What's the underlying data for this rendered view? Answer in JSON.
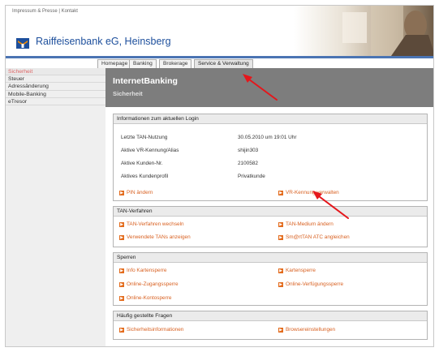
{
  "header": {
    "toplinks": [
      "Impressum & Presse",
      "Kontakt"
    ],
    "bank_name": "Raiffeisenbank eG, Heinsberg"
  },
  "tabs": [
    {
      "label": "Homepage"
    },
    {
      "label": "Banking"
    },
    {
      "label": "Brokerage"
    },
    {
      "label": "Service & Verwaltung"
    }
  ],
  "sidebar": {
    "items": [
      {
        "label": "Sicherheit"
      },
      {
        "label": "Steuer"
      },
      {
        "label": "Adressänderung"
      },
      {
        "label": "Mobile-Banking"
      },
      {
        "label": "eTresor"
      }
    ]
  },
  "hero": {
    "title": "InternetBanking",
    "subtitle": "Sicherheit"
  },
  "login_panel": {
    "title": "Informationen zum aktuellen Login",
    "rows": [
      {
        "label": "Letzte TAN-Nutzung",
        "value": "30.05.2010 um 19:01 Uhr"
      },
      {
        "label": "Aktive VR-Kennung/Alias",
        "value": "shijin303"
      },
      {
        "label": "Aktive Kunden-Nr.",
        "value": "2100582"
      },
      {
        "label": "Aktives Kundenprofil",
        "value": "Privatkunde"
      }
    ],
    "links": [
      "PIN ändern",
      "VR-Kennung verwalten"
    ]
  },
  "tan_panel": {
    "title": "TAN-Verfahren",
    "links": [
      "TAN-Verfahren wechseln",
      "TAN-Medium ändern",
      "Verwendete TANs anzeigen",
      "Sm@rtTAN ATC angleichen"
    ]
  },
  "sperren_panel": {
    "title": "Sperren",
    "links": [
      "Info Kartensperre",
      "Kartensperre",
      "Online-Zugangssperre",
      "Online-Verfügungssperre",
      "Online-Kontosperre"
    ]
  },
  "faq_panel": {
    "title": "Häufig gestellte Fragen",
    "links": [
      "Sicherheitsinformationen",
      "Browsereinstellungen"
    ]
  },
  "colors": {
    "link_orange": "#d86020",
    "brand_blue": "#1d4f9c",
    "annotation_red": "#e5161b"
  }
}
